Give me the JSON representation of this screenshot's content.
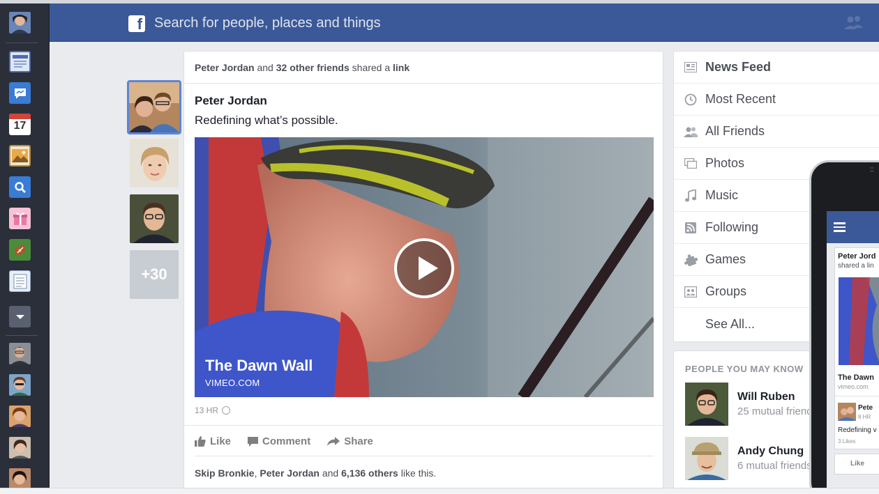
{
  "search": {
    "placeholder": "Search for people, places and things"
  },
  "dock": {
    "apps": [
      {
        "icon": "news-feed-icon",
        "color": "#4d6db0"
      },
      {
        "icon": "messages-icon",
        "color": "#3a7bd5"
      },
      {
        "icon": "calendar-icon",
        "label": "17",
        "color": "#d0443a"
      },
      {
        "icon": "photos-icon",
        "color": "#c48a2b"
      },
      {
        "icon": "search-icon",
        "color": "#3a7bd5"
      },
      {
        "icon": "gift-icon",
        "color": "#e87aa8"
      },
      {
        "icon": "games-icon",
        "color": "#4a8c3a"
      },
      {
        "icon": "notes-icon",
        "color": "#e8eef7"
      },
      {
        "icon": "more-icon",
        "color": "#5a6070"
      }
    ]
  },
  "friends_column": {
    "more_label": "+30"
  },
  "post": {
    "share_actor": "Peter Jordan",
    "share_and": "and",
    "share_others": "32 other friends",
    "share_verb": "shared a",
    "share_object": "link",
    "author": "Peter Jordan",
    "caption": "Redefining what’s possible.",
    "video_title": "The Dawn Wall",
    "video_source": "VIMEO.COM",
    "timestamp": "13 HR",
    "actions": {
      "like": "Like",
      "comment": "Comment",
      "share": "Share"
    },
    "likes": {
      "name1": "Skip Bronkie",
      "sep": ",",
      "name2": "Peter Jordan",
      "and": "and",
      "count": "6,136 others",
      "suffix": "like this."
    }
  },
  "nav": {
    "items": [
      {
        "label": "News Feed",
        "icon": "news-feed-icon"
      },
      {
        "label": "Most Recent",
        "icon": "clock-icon"
      },
      {
        "label": "All Friends",
        "icon": "friends-icon"
      },
      {
        "label": "Photos",
        "icon": "photos-icon"
      },
      {
        "label": "Music",
        "icon": "music-note-icon"
      },
      {
        "label": "Following",
        "icon": "rss-icon"
      },
      {
        "label": "Games",
        "icon": "puzzle-icon"
      },
      {
        "label": "Groups",
        "icon": "groups-icon"
      },
      {
        "label": "See All...",
        "icon": ""
      }
    ]
  },
  "pymk": {
    "title": "PEOPLE YOU MAY KNOW",
    "people": [
      {
        "name": "Will Ruben",
        "mutual": "25 mutual friends"
      },
      {
        "name": "Andy Chung",
        "mutual": "6 mutual friends"
      }
    ]
  },
  "phone": {
    "author": "Peter Jord",
    "subline": "shared a lin",
    "video_title": "The Dawn",
    "video_source": "vimeo.com",
    "second_author": "Pete",
    "second_time": "8 HR",
    "caption": "Redefining v",
    "likes": "3 Likes",
    "like_button": "Like"
  },
  "colors": {
    "brand": "#3b5998",
    "dock": "#2a2f3a",
    "background": "#e9ebee"
  }
}
